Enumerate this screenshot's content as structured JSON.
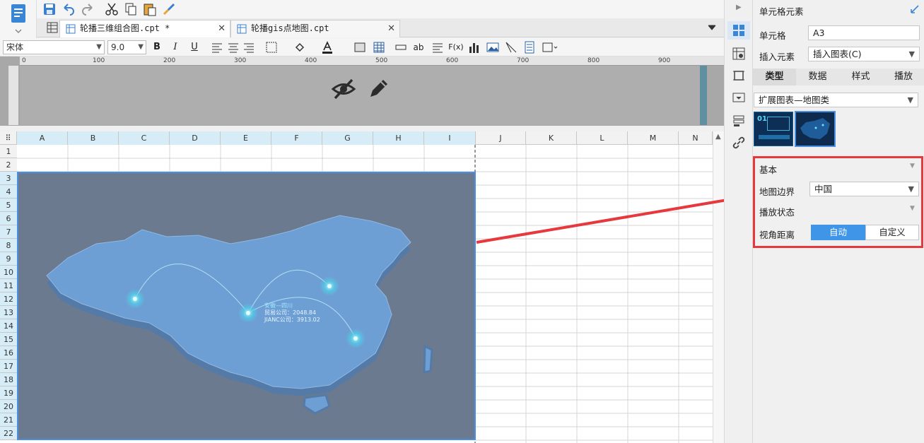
{
  "tabs": [
    {
      "label": "轮播三维组合图.cpt *",
      "active": true
    },
    {
      "label": "轮播gis点地图.cpt",
      "active": false
    }
  ],
  "toolbar": {
    "font_family": "宋体",
    "font_size": "9.0",
    "bold": "B",
    "italic": "I",
    "underline": "U",
    "ab": "ab",
    "fx": "F(x)"
  },
  "ruler": {
    "ticks": [
      "0",
      "100",
      "200",
      "300",
      "400",
      "500",
      "600",
      "700",
      "800",
      "900"
    ]
  },
  "grid": {
    "columns": [
      "A",
      "B",
      "C",
      "D",
      "E",
      "F",
      "G",
      "H",
      "I",
      "J",
      "K",
      "L",
      "M",
      "N"
    ],
    "rows": [
      "1",
      "2",
      "3",
      "4",
      "5",
      "6",
      "7",
      "8",
      "9",
      "10",
      "11",
      "12",
      "13",
      "14",
      "15",
      "16",
      "17",
      "18",
      "19",
      "20",
      "21",
      "22"
    ],
    "selected_cell": "A3"
  },
  "map": {
    "tooltip": {
      "line1": "安徽—四川",
      "line2": "贸易公司：2048.84",
      "line3": "JIANC公司：3913.02"
    }
  },
  "panel": {
    "title": "单元格元素",
    "cell_label": "单元格",
    "cell_value": "A3",
    "insert_label": "插入元素",
    "insert_value": "插入图表(C)",
    "tabs": [
      "类型",
      "数据",
      "样式",
      "播放"
    ],
    "active_tab": "类型",
    "chart_category": "扩展图表—地图类",
    "thumb1_text": "01",
    "sections": {
      "basic": "基本",
      "map_border_label": "地图边界",
      "map_border_value": "中国",
      "play_state": "播放状态",
      "view_distance_label": "视角距离",
      "view_auto": "自动",
      "view_custom": "自定义"
    }
  },
  "colors": {
    "accent": "#4a90e2",
    "highlight": "#e5393e",
    "map_bg": "#6b7a8f",
    "map_fill": "#6e9fd4"
  }
}
